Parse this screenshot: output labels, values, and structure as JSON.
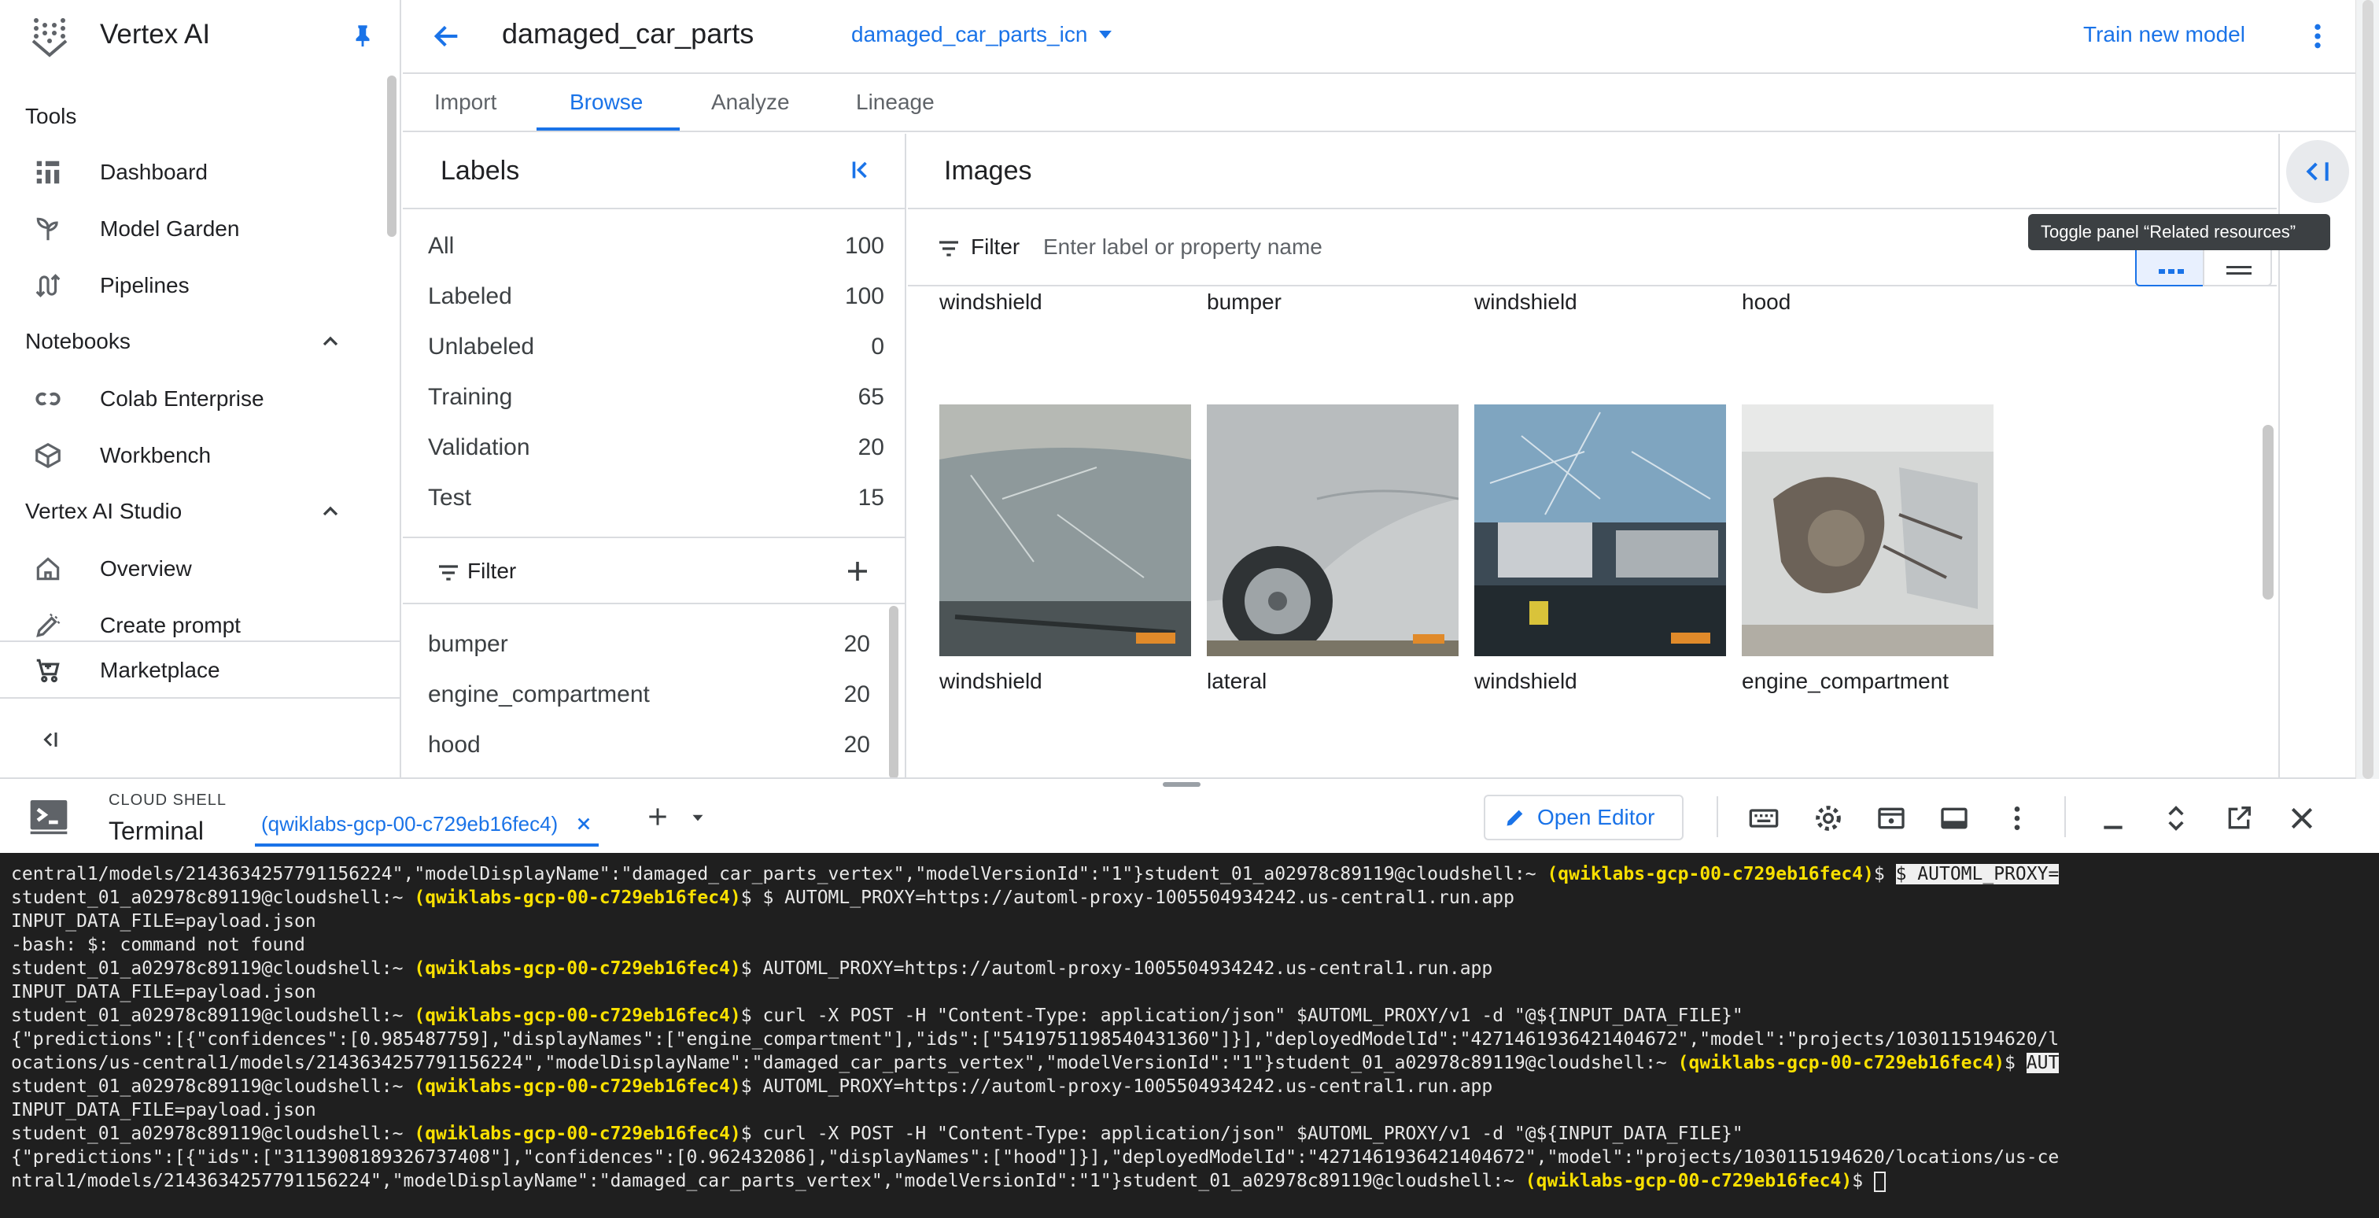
{
  "nav": {
    "app_title": "Vertex AI",
    "sections": {
      "tools": "Tools",
      "notebooks": "Notebooks",
      "studio": "Vertex AI Studio"
    },
    "items": [
      {
        "label": "Dashboard",
        "icon": "dashboard-icon"
      },
      {
        "label": "Model Garden",
        "icon": "model-garden-icon"
      },
      {
        "label": "Pipelines",
        "icon": "pipelines-icon"
      },
      {
        "label": "Colab Enterprise",
        "icon": "colab-icon"
      },
      {
        "label": "Workbench",
        "icon": "workbench-icon"
      },
      {
        "label": "Overview",
        "icon": "home-icon"
      },
      {
        "label": "Create prompt",
        "icon": "pen-icon"
      }
    ],
    "marketplace": "Marketplace"
  },
  "header": {
    "dataset_name": "damaged_car_parts",
    "dataset_select": "damaged_car_parts_icn",
    "train_button": "Train new model"
  },
  "tabs": [
    {
      "label": "Import"
    },
    {
      "label": "Browse"
    },
    {
      "label": "Analyze"
    },
    {
      "label": "Lineage"
    }
  ],
  "labels_panel": {
    "title": "Labels",
    "counts": [
      {
        "name": "All",
        "value": "100"
      },
      {
        "name": "Labeled",
        "value": "100"
      },
      {
        "name": "Unlabeled",
        "value": "0"
      },
      {
        "name": "Training",
        "value": "65"
      },
      {
        "name": "Validation",
        "value": "20"
      },
      {
        "name": "Test",
        "value": "15"
      }
    ],
    "filter_label": "Filter",
    "label_counts": [
      {
        "name": "bumper",
        "value": "20"
      },
      {
        "name": "engine_compartment",
        "value": "20"
      },
      {
        "name": "hood",
        "value": "20"
      }
    ]
  },
  "images_panel": {
    "title": "Images",
    "filter_label": "Filter",
    "filter_placeholder": "Enter label or property name",
    "top_row_labels": [
      "windshield",
      "bumper",
      "windshield",
      "hood"
    ],
    "bottom_row_labels": [
      "windshield",
      "lateral",
      "windshield",
      "engine_compartment"
    ]
  },
  "tooltip": "Toggle panel “Related resources”",
  "shell": {
    "product": "CLOUD SHELL",
    "title": "Terminal",
    "tab_label": "(qwiklabs-gcp-00-c729eb16fec4)",
    "open_editor": "Open Editor"
  },
  "terminal": {
    "prompt": "student_01_a02978c89119@cloudshell:~",
    "project": "(qwiklabs-gcp-00-c729eb16fec4)",
    "lines": {
      "l1a": "central1/models/2143634257791156224\",\"modelDisplayName\":\"damaged_car_parts_vertex\",\"modelVersionId\":\"1\"}student_01_a02978c89119@cloudshell:~ ",
      "l1sel": "$ AUTOML_PROXY=",
      "l2b": "$ $ AUTOML_PROXY=https://automl-proxy-1005504934242.us-central1.run.app",
      "l3": "INPUT_DATA_FILE=payload.json",
      "l4": "-bash: $: command not found",
      "l5b": "$ AUTOML_PROXY=https://automl-proxy-1005504934242.us-central1.run.app",
      "l6": "INPUT_DATA_FILE=payload.json",
      "l7b": "$ curl -X POST -H \"Content-Type: application/json\" $AUTOML_PROXY/v1 -d \"@${INPUT_DATA_FILE}\"",
      "l8": "{\"predictions\":[{\"confidences\":[0.985487759],\"displayNames\":[\"engine_compartment\"],\"ids\":[\"5419751198540431360\"]}],\"deployedModelId\":\"4271461936421404672\",\"model\":\"projects/1030115194620/l",
      "l9a": "ocations/us-central1/models/2143634257791156224\",\"modelDisplayName\":\"damaged_car_parts_vertex\",\"modelVersionId\":\"1\"}student_01_a02978c89119@cloudshell:~ ",
      "l9c": "$ ",
      "l9sel": "AUT",
      "l10b": "$ AUTOML_PROXY=https://automl-proxy-1005504934242.us-central1.run.app",
      "l11": "INPUT_DATA_FILE=payload.json",
      "l12b": "$ curl -X POST -H \"Content-Type: application/json\" $AUTOML_PROXY/v1 -d \"@${INPUT_DATA_FILE}\"",
      "l13": "{\"predictions\":[{\"ids\":[\"3113908189326737408\"],\"confidences\":[0.962432086],\"displayNames\":[\"hood\"]}],\"deployedModelId\":\"4271461936421404672\",\"model\":\"projects/1030115194620/locations/us-ce",
      "l14a": "ntral1/models/2143634257791156224\",\"modelDisplayName\":\"damaged_car_parts_vertex\",\"modelVersionId\":\"1\"}student_01_a02978c89119@cloudshell:~ ",
      "l14c": "$ "
    }
  },
  "colors": {
    "accent": "#1a73e8",
    "terminal_bg": "#1f1f1f",
    "terminal_project": "#f9e000"
  }
}
